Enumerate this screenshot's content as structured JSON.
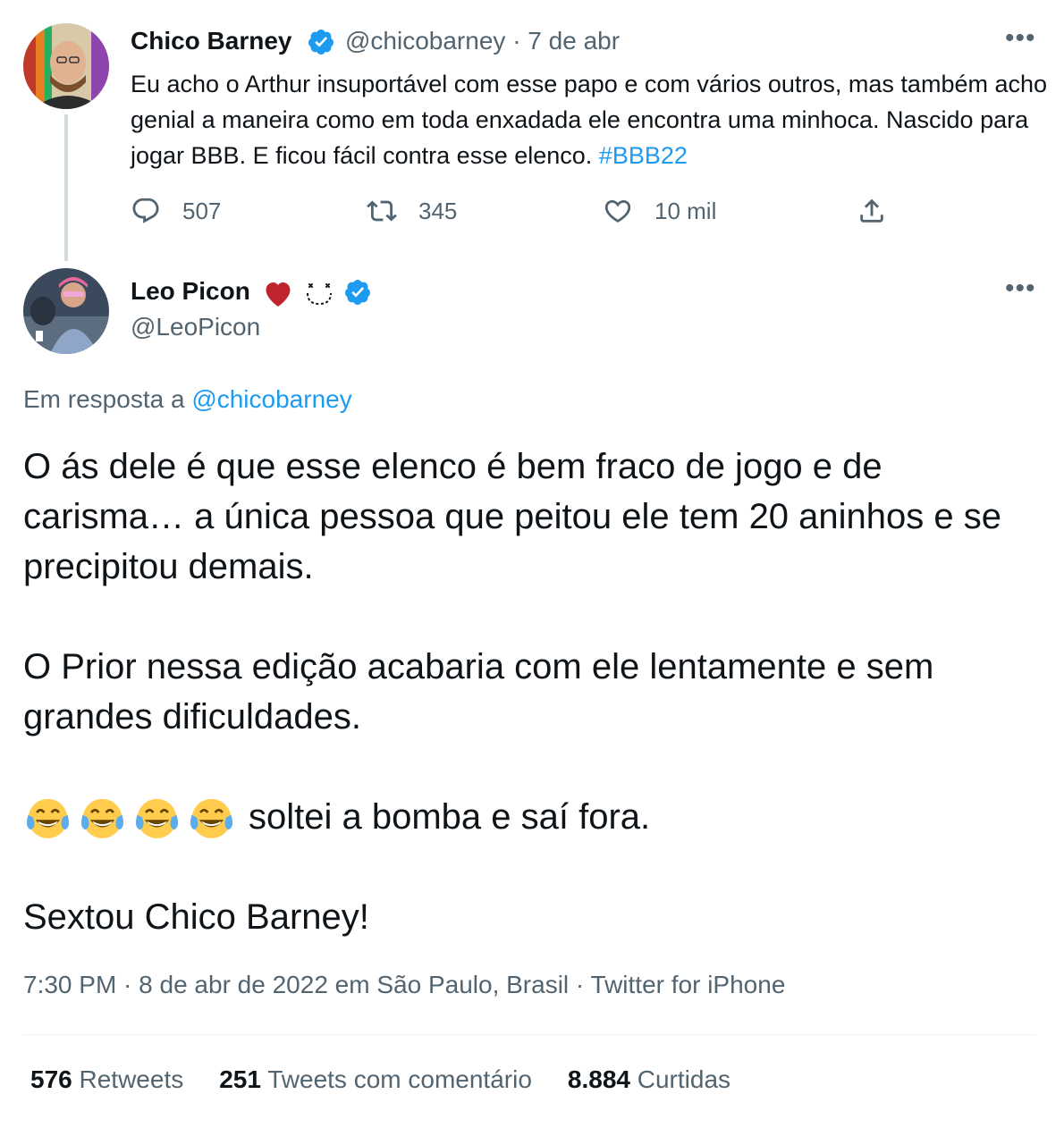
{
  "quoted_tweet": {
    "author_name": "Chico Barney",
    "author_handle": "@chicobarney",
    "date": "· 7 de abr",
    "text": "Eu acho o Arthur insuportável com esse papo e com vários outros, mas também acho genial a maneira como em toda enxadada ele encontra uma minhoca. Nascido para jogar BBB. E ficou fácil contra esse elenco.",
    "hashtag": "#BBB22",
    "reply_count": "507",
    "retweet_count": "345",
    "like_count": "10 mil"
  },
  "main_tweet": {
    "author_name": "Leo Picon",
    "author_handle": "@LeoPicon",
    "reply_prefix": "Em resposta a",
    "reply_to": "@chicobarney",
    "paragraph1": "O ás dele é que esse elenco é bem fraco de jogo e de carisma… a única pessoa que peitou ele tem 20 aninhos e se precipitou demais.",
    "paragraph2": "O Prior nessa edição acabaria com ele lentamente e sem grandes dificuldades.",
    "paragraph3": "soltei a bomba e saí fora.",
    "paragraph4": "Sextou Chico Barney!",
    "timestamp": "7:30 PM · 8 de abr de 2022 em São Paulo, Brasil · Twitter for iPhone"
  },
  "stats": {
    "retweets_count": "576",
    "retweets_label": "Retweets",
    "quotes_count": "251",
    "quotes_label": "Tweets com comentário",
    "likes_count": "8.884",
    "likes_label": "Curtidas"
  },
  "colors": {
    "link": "#1d9bf0",
    "secondary_text": "#536471",
    "primary_text": "#0f1419",
    "heart": "#c0242f"
  }
}
